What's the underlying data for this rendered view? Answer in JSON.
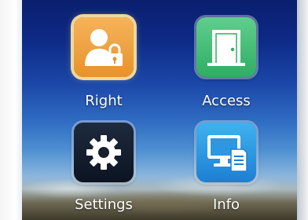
{
  "menu": {
    "items": [
      {
        "label": "Right",
        "icon": "user-lock-icon",
        "color": "#f0a64a"
      },
      {
        "label": "Access",
        "icon": "door-icon",
        "color": "#3dbd73"
      },
      {
        "label": "Settings",
        "icon": "gear-icon",
        "color": "#17202f"
      },
      {
        "label": "Info",
        "icon": "computer-document-icon",
        "color": "#2d97e2"
      }
    ]
  }
}
